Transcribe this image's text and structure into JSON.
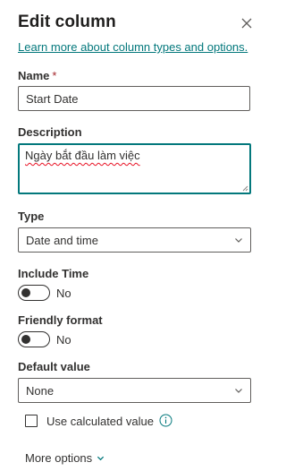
{
  "panel": {
    "title": "Edit column",
    "learn_more": "Learn more about column types and options.",
    "accent_color": "#03787c"
  },
  "name_field": {
    "label": "Name",
    "required_mark": "*",
    "value": "Start Date"
  },
  "description_field": {
    "label": "Description",
    "value": "Ngày bắt đầu làm việc"
  },
  "type_field": {
    "label": "Type",
    "selected": "Date and time"
  },
  "include_time": {
    "label": "Include Time",
    "state": "No",
    "on": false
  },
  "friendly_format": {
    "label": "Friendly format",
    "state": "No",
    "on": false
  },
  "default_value": {
    "label": "Default value",
    "selected": "None"
  },
  "calculated": {
    "label": "Use calculated value",
    "checked": false
  },
  "more_options": {
    "label": "More options"
  },
  "icons": {
    "close": "close-icon",
    "chevron": "chevron-down-icon",
    "info": "info-icon"
  }
}
